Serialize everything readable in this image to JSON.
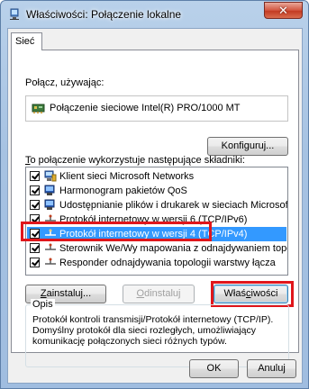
{
  "window": {
    "title": "Właściwości: Połączenie lokalne",
    "close_glyph": "✕"
  },
  "tab": {
    "label": "Sieć"
  },
  "connect_using": {
    "label": "Połącz, używając:",
    "adapter": "Połączenie sieciowe Intel(R) PRO/1000 MT",
    "adapter_icon": "network-adapter-icon"
  },
  "configure_button": {
    "label": "Konfiguruj..."
  },
  "components": {
    "label_prefix": "T",
    "label_rest": "o połączenie wykorzystuje następujące składniki:",
    "items": [
      {
        "label": "Klient sieci Microsoft Networks",
        "checked": true,
        "icon": "network-client-icon"
      },
      {
        "label": "Harmonogram pakietów QoS",
        "checked": true,
        "icon": "qos-scheduler-icon"
      },
      {
        "label": "Udostępnianie plików i drukarek w sieciach Microsoft N...",
        "checked": true,
        "icon": "file-printer-sharing-icon"
      },
      {
        "label": "Protokół internetowy w wersji 6 (TCP/IPv6)",
        "checked": true,
        "icon": "protocol-icon"
      },
      {
        "label": "Protokół internetowy w wersji 4 (TCP/IPv4)",
        "checked": true,
        "icon": "protocol-icon",
        "selected": true
      },
      {
        "label": "Sterownik We/Wy mapowania z odnajdywaniem topolo...",
        "checked": true,
        "icon": "protocol-icon"
      },
      {
        "label": "Responder odnajdywania topologii warstwy łącza",
        "checked": true,
        "icon": "protocol-icon"
      }
    ]
  },
  "buttons": {
    "install_u": "Z",
    "install_rest": "ainstaluj...",
    "uninstall_u": "O",
    "uninstall_rest": "dinstaluj",
    "properties_a": "Właś",
    "properties_u": "c",
    "properties_b": "iwości",
    "ok": "OK",
    "cancel": "Anuluj"
  },
  "description": {
    "title": "Opis",
    "text": "Protokół kontroli transmisji/Protokół internetowy (TCP/IP). Domyślny protokół dla sieci rozległych, umożliwiający komunikację połączonych sieci różnych typów."
  },
  "colors": {
    "selection": "#3399ff",
    "highlight": "#e0161b",
    "close_button": "#c33a22"
  }
}
